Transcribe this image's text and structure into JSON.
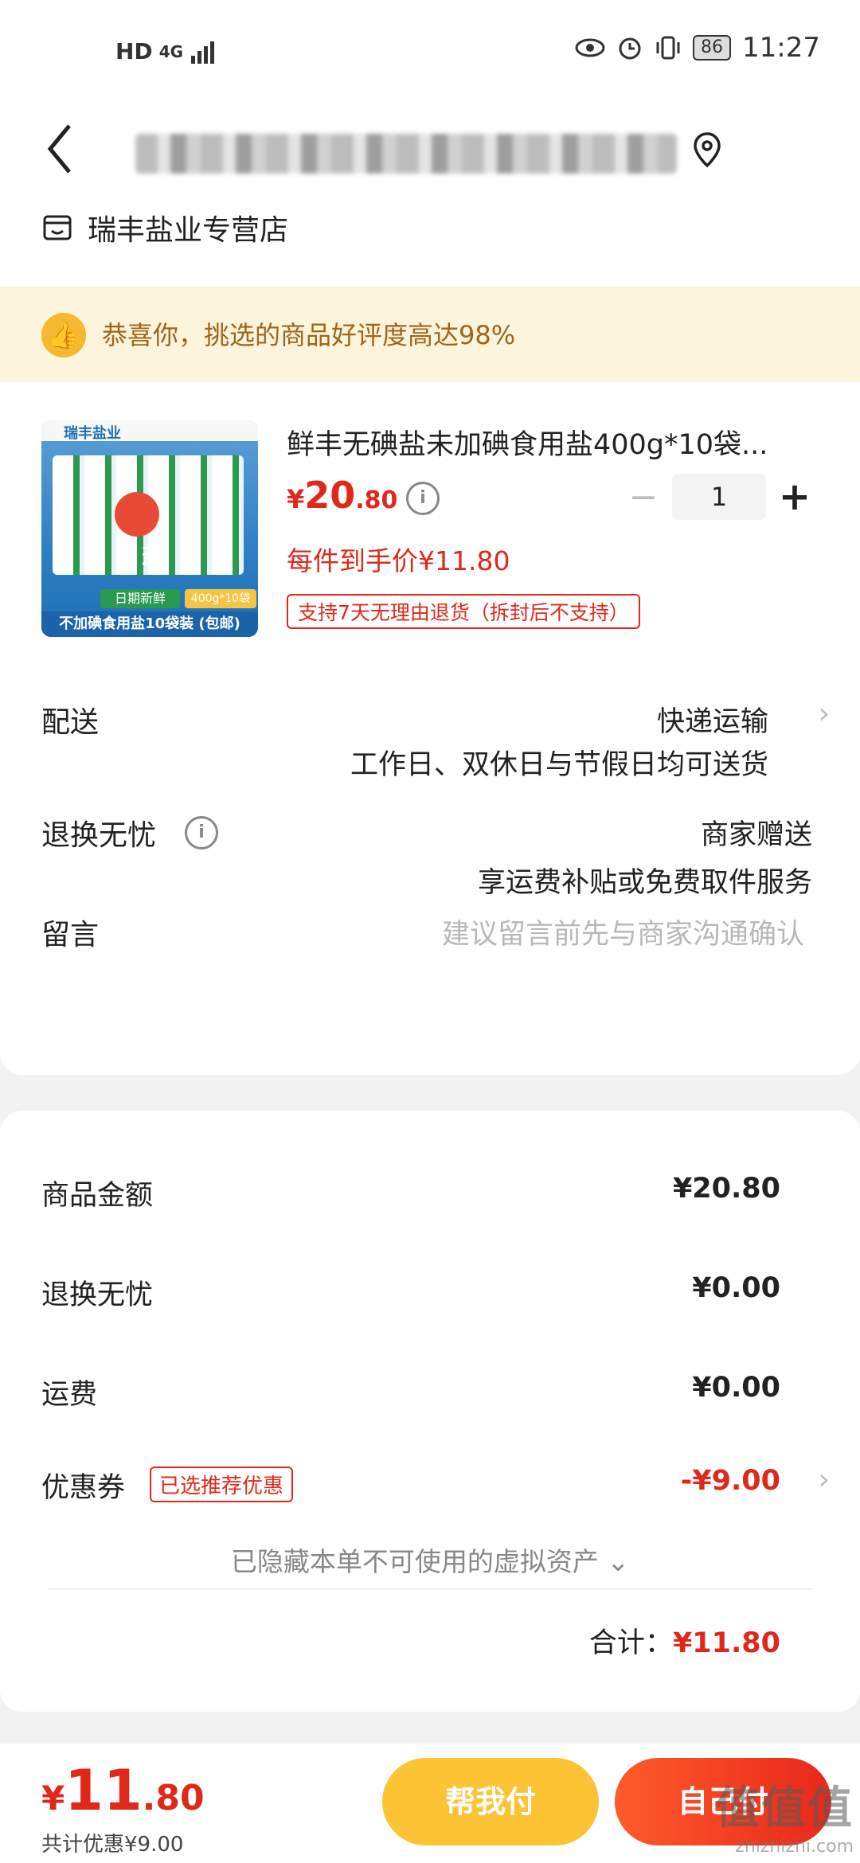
{
  "status_bar": {
    "network": "HD",
    "signal": "4G",
    "battery": "86",
    "time": "11:27"
  },
  "header": {
    "store_name": "瑞丰盐业专营店"
  },
  "notice": {
    "text": "恭喜你，挑选的商品好评度高达98%"
  },
  "product": {
    "title": "鲜丰无碘盐未加碘食用盐400g*10袋...",
    "price_symbol": "¥",
    "price_int": "20",
    "price_dec": ".80",
    "quantity": "1",
    "unit_price_text": "每件到手价¥11.80",
    "return_policy": "支持7天无理由退货（拆封后不支持）",
    "image": {
      "brand": "瑞丰盐业",
      "label_fresh": "日期新鲜",
      "label_spec": "400g*10袋",
      "caption": "不加碘食用盐10袋装 (包邮)",
      "salt_char": "盐"
    }
  },
  "delivery": {
    "label": "配送",
    "method": "快递运输",
    "schedule": "工作日、双休日与节假日均可送货"
  },
  "worry_free": {
    "label": "退换无忧",
    "provider": "商家赠送",
    "desc": "享运费补贴或免费取件服务"
  },
  "message": {
    "label": "留言",
    "placeholder": "建议留言前先与商家沟通确认"
  },
  "summary": {
    "goods_label": "商品金额",
    "goods_value": "¥20.80",
    "worry_label": "退换无忧",
    "worry_value": "¥0.00",
    "shipping_label": "运费",
    "shipping_value": "¥0.00",
    "coupon_label": "优惠券",
    "coupon_tag": "已选推荐优惠",
    "coupon_value": "-¥9.00",
    "hidden_note": "已隐藏本单不可使用的虚拟资产",
    "total_label": "合计：",
    "total_value": "¥11.80"
  },
  "bottom_bar": {
    "price_symbol": "¥",
    "price_int": "11",
    "price_dec": ".80",
    "discount_text": "共计优惠¥9.00",
    "help_pay_label": "帮我付",
    "self_pay_label": "自己付"
  },
  "watermark": {
    "text": "值值值",
    "site": "zhizhizhi.com"
  },
  "colors": {
    "accent_red": "#e0281a",
    "help_button": "#fcc434",
    "notice_bg": "#fdf4dc"
  }
}
